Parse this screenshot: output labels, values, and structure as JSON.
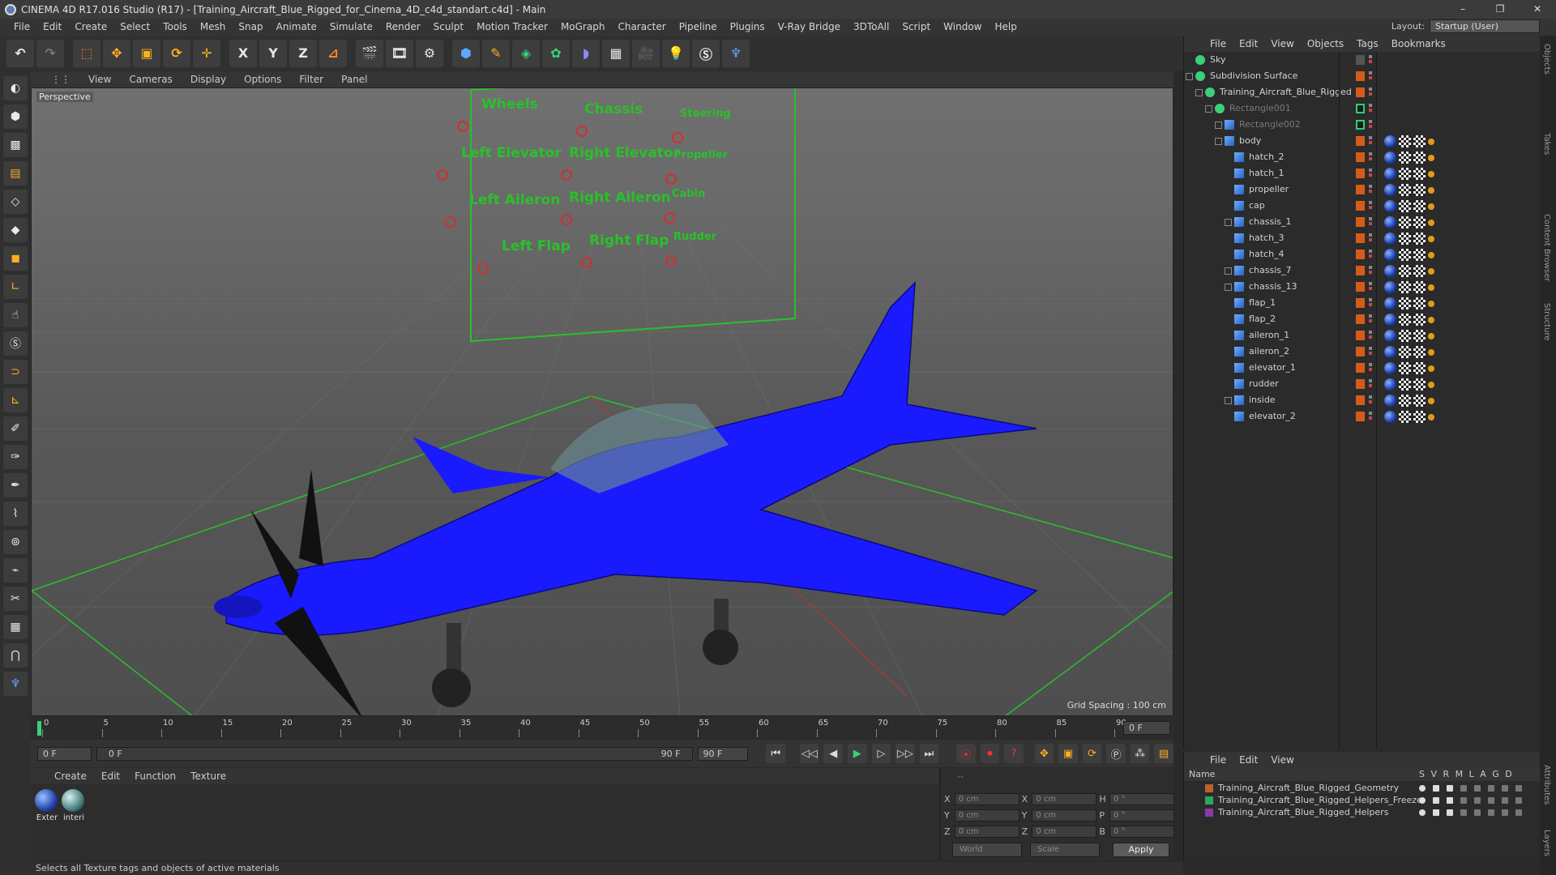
{
  "window": {
    "title": "CINEMA 4D R17.016 Studio (R17) - [Training_Aircraft_Blue_Rigged_for_Cinema_4D_c4d_standart.c4d] - Main",
    "controls": [
      "–",
      "❐",
      "✕"
    ]
  },
  "menubar": {
    "items": [
      "File",
      "Edit",
      "Create",
      "Select",
      "Tools",
      "Mesh",
      "Snap",
      "Animate",
      "Simulate",
      "Render",
      "Sculpt",
      "Motion Tracker",
      "MoGraph",
      "Character",
      "Pipeline",
      "Plugins",
      "V-Ray Bridge",
      "3DToAll",
      "Script",
      "Window",
      "Help"
    ],
    "layout_label": "Layout:",
    "layout_value": "Startup (User)"
  },
  "toolbar": {
    "axis_x": "X",
    "axis_y": "Y",
    "axis_z": "Z"
  },
  "viewport": {
    "menu": [
      "View",
      "Cameras",
      "Display",
      "Options",
      "Filter",
      "Panel"
    ],
    "label": "Perspective",
    "grid_spacing": "Grid Spacing : 100 cm",
    "controller_labels": [
      "Wheels",
      "Chassis",
      "Steering",
      "Left Elevator",
      "Right Elevator",
      "Propeller",
      "Left Aileron",
      "Right Aileron",
      "Cabin",
      "Left Flap",
      "Right Flap",
      "Rudder"
    ]
  },
  "timeline": {
    "ticks": [
      "0",
      "5",
      "10",
      "15",
      "20",
      "25",
      "30",
      "35",
      "40",
      "45",
      "50",
      "55",
      "60",
      "65",
      "70",
      "75",
      "80",
      "85",
      "90"
    ],
    "current_frame_right": "0 F",
    "start_field": "0 F",
    "range_start": "0 F",
    "range_end": "90 F",
    "end_field": "90 F"
  },
  "materials": {
    "menu": [
      "Create",
      "Edit",
      "Function",
      "Texture"
    ],
    "items": [
      {
        "label": "Exter"
      },
      {
        "label": "interi"
      }
    ]
  },
  "coords": {
    "header": "--",
    "rows": [
      {
        "a": "X",
        "v1": "0 cm",
        "b": "X",
        "v2": "0 cm",
        "c": "H",
        "v3": "0 °"
      },
      {
        "a": "Y",
        "v1": "0 cm",
        "b": "Y",
        "v2": "0 cm",
        "c": "P",
        "v3": "0 °"
      },
      {
        "a": "Z",
        "v1": "0 cm",
        "b": "Z",
        "v2": "0 cm",
        "c": "B",
        "v3": "0 °"
      }
    ],
    "world": "World",
    "scale": "Scale",
    "apply": "Apply"
  },
  "status": "Selects all Texture tags and objects of active materials",
  "objects": {
    "menu": [
      "File",
      "Edit",
      "View",
      "Objects",
      "Tags",
      "Bookmarks"
    ],
    "items": [
      {
        "name": "Sky",
        "indent": 0,
        "tagcolor": "none"
      },
      {
        "name": "Subdivision Surface",
        "indent": 0,
        "tagcolor": "orange"
      },
      {
        "name": "Training_Aircraft_Blue_Rigged",
        "indent": 1,
        "tagcolor": "orange"
      },
      {
        "name": "Rectangle001",
        "indent": 2,
        "tagcolor": "green"
      },
      {
        "name": "Rectangle002",
        "indent": 3,
        "tagcolor": "green"
      },
      {
        "name": "body",
        "indent": 3,
        "tagcolor": "orange"
      },
      {
        "name": "hatch_2",
        "indent": 4,
        "tagcolor": "orange"
      },
      {
        "name": "hatch_1",
        "indent": 4,
        "tagcolor": "orange"
      },
      {
        "name": "propeller",
        "indent": 4,
        "tagcolor": "orange"
      },
      {
        "name": "cap",
        "indent": 4,
        "tagcolor": "orange"
      },
      {
        "name": "chassis_1",
        "indent": 4,
        "tagcolor": "orange"
      },
      {
        "name": "hatch_3",
        "indent": 4,
        "tagcolor": "orange"
      },
      {
        "name": "hatch_4",
        "indent": 4,
        "tagcolor": "orange"
      },
      {
        "name": "chassis_7",
        "indent": 4,
        "tagcolor": "orange"
      },
      {
        "name": "chassis_13",
        "indent": 4,
        "tagcolor": "orange"
      },
      {
        "name": "flap_1",
        "indent": 4,
        "tagcolor": "orange"
      },
      {
        "name": "flap_2",
        "indent": 4,
        "tagcolor": "orange"
      },
      {
        "name": "aileron_1",
        "indent": 4,
        "tagcolor": "orange"
      },
      {
        "name": "aileron_2",
        "indent": 4,
        "tagcolor": "orange"
      },
      {
        "name": "elevator_1",
        "indent": 4,
        "tagcolor": "orange"
      },
      {
        "name": "rudder",
        "indent": 4,
        "tagcolor": "orange"
      },
      {
        "name": "inside",
        "indent": 4,
        "tagcolor": "orange"
      },
      {
        "name": "elevator_2",
        "indent": 4,
        "tagcolor": "orange"
      }
    ]
  },
  "layers": {
    "menu": [
      "File",
      "Edit",
      "View"
    ],
    "header_name": "Name",
    "header_cols": "S V R M L A G D",
    "items": [
      {
        "name": "Training_Aircraft_Blue_Rigged_Geometry",
        "color": "#c0602a"
      },
      {
        "name": "Training_Aircraft_Blue_Rigged_Helpers_Freeze",
        "color": "#2aa860"
      },
      {
        "name": "Training_Aircraft_Blue_Rigged_Helpers",
        "color": "#8a3aa8"
      }
    ]
  },
  "side_tabs": [
    "Objects",
    "Takes",
    "Content Browser",
    "Structure",
    "Attributes",
    "Layers"
  ],
  "colors": {
    "accent": "#1a1aff",
    "controller_green": "#2ac02a",
    "tag_orange": "#d35c1c"
  }
}
